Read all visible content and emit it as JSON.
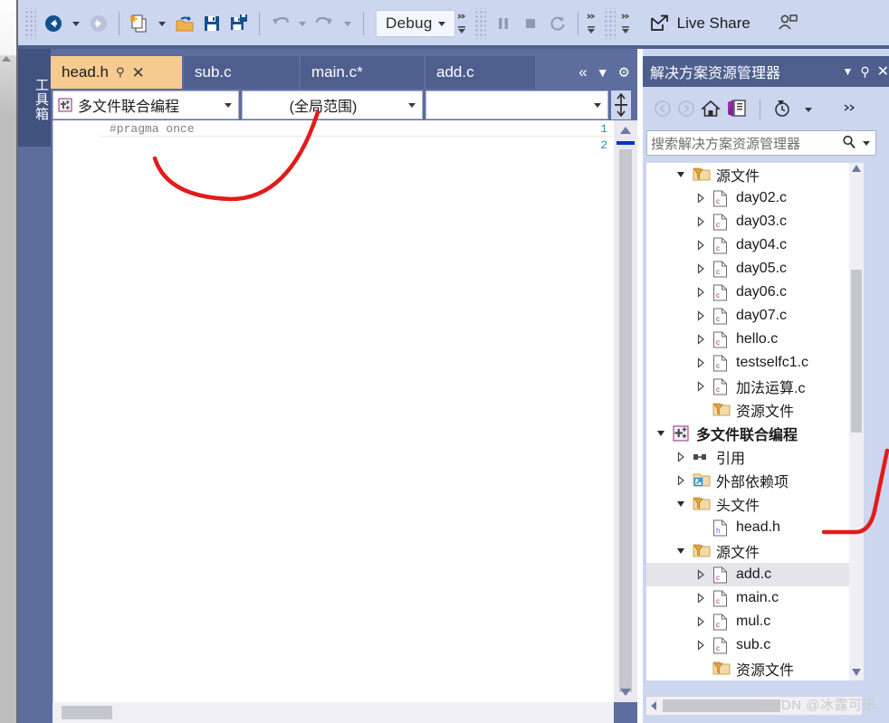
{
  "toolbar": {
    "items": [
      {
        "name": "grip",
        "label": ""
      },
      {
        "name": "navigate-backward-icon",
        "label": ""
      },
      {
        "name": "navigate-backward-dropdown",
        "label": ""
      },
      {
        "name": "navigate-forward-icon",
        "label": ""
      },
      {
        "name": "new-item-icon",
        "label": ""
      },
      {
        "name": "new-item-dropdown",
        "label": ""
      },
      {
        "name": "open-file-icon",
        "label": ""
      },
      {
        "name": "save-icon",
        "label": ""
      },
      {
        "name": "save-all-icon",
        "label": ""
      },
      {
        "name": "undo-icon",
        "label": ""
      },
      {
        "name": "redo-icon",
        "label": ""
      }
    ],
    "config_label": "Debug",
    "pause_label": "",
    "stop_label": "",
    "restart_label": "",
    "live_share_label": "Live Share"
  },
  "toolbox": {
    "label": "工具箱"
  },
  "editor": {
    "tabs": [
      {
        "label": "head.h",
        "active": true,
        "modified": false
      },
      {
        "label": "sub.c",
        "active": false,
        "modified": false
      },
      {
        "label": "main.c*",
        "active": false,
        "modified": true
      },
      {
        "label": "add.c",
        "active": false,
        "modified": false
      }
    ],
    "tabstrip_buttons": [
      "«",
      "▼",
      "⚙"
    ],
    "nav": {
      "project": "多文件联合编程",
      "scope": "(全局范围)",
      "member": ""
    },
    "lines": [
      {
        "number": "1",
        "text": "#pragma once"
      },
      {
        "number": "2",
        "text": ""
      }
    ]
  },
  "solution_explorer": {
    "title": "解决方案资源管理器",
    "toolbar_icons": [
      "back-icon",
      "forward-icon",
      "home-icon",
      "sync-with-active-document-icon",
      "pending-changes-icon"
    ],
    "search_placeholder": "搜索解决方案资源管理器",
    "tree": [
      {
        "indent": 1,
        "arrow": "open",
        "icon": "folder-filter",
        "label": "源文件",
        "bold": false,
        "selected": false
      },
      {
        "indent": 2,
        "arrow": "closed",
        "icon": "c-file",
        "label": "day02.c",
        "bold": false,
        "selected": false
      },
      {
        "indent": 2,
        "arrow": "closed",
        "icon": "c-file",
        "label": "day03.c",
        "bold": false,
        "selected": false
      },
      {
        "indent": 2,
        "arrow": "closed",
        "icon": "c-file",
        "label": "day04.c",
        "bold": false,
        "selected": false
      },
      {
        "indent": 2,
        "arrow": "closed",
        "icon": "c-file",
        "label": "day05.c",
        "bold": false,
        "selected": false
      },
      {
        "indent": 2,
        "arrow": "closed",
        "icon": "c-file",
        "label": "day06.c",
        "bold": false,
        "selected": false
      },
      {
        "indent": 2,
        "arrow": "closed",
        "icon": "c-file",
        "label": "day07.c",
        "bold": false,
        "selected": false
      },
      {
        "indent": 2,
        "arrow": "closed",
        "icon": "c-file",
        "label": "hello.c",
        "bold": false,
        "selected": false
      },
      {
        "indent": 2,
        "arrow": "closed",
        "icon": "c-file",
        "label": "testselfc1.c",
        "bold": false,
        "selected": false
      },
      {
        "indent": 2,
        "arrow": "closed",
        "icon": "c-file",
        "label": "加法运算.c",
        "bold": false,
        "selected": false
      },
      {
        "indent": 2,
        "arrow": "none",
        "icon": "folder-filter",
        "label": "资源文件",
        "bold": false,
        "selected": false
      },
      {
        "indent": 0,
        "arrow": "open",
        "icon": "project",
        "label": "多文件联合编程",
        "bold": true,
        "selected": false
      },
      {
        "indent": 1,
        "arrow": "closed",
        "icon": "references",
        "label": "引用",
        "bold": false,
        "selected": false
      },
      {
        "indent": 1,
        "arrow": "closed",
        "icon": "ext-deps",
        "label": "外部依赖项",
        "bold": false,
        "selected": false
      },
      {
        "indent": 1,
        "arrow": "open",
        "icon": "folder-filter",
        "label": "头文件",
        "bold": false,
        "selected": false
      },
      {
        "indent": 2,
        "arrow": "none",
        "icon": "h-file",
        "label": "head.h",
        "bold": false,
        "selected": false
      },
      {
        "indent": 1,
        "arrow": "open",
        "icon": "folder-filter",
        "label": "源文件",
        "bold": false,
        "selected": false
      },
      {
        "indent": 2,
        "arrow": "closed",
        "icon": "c-file",
        "label": "add.c",
        "bold": false,
        "selected": true
      },
      {
        "indent": 2,
        "arrow": "closed",
        "icon": "c-file",
        "label": "main.c",
        "bold": false,
        "selected": false
      },
      {
        "indent": 2,
        "arrow": "closed",
        "icon": "c-file",
        "label": "mul.c",
        "bold": false,
        "selected": false
      },
      {
        "indent": 2,
        "arrow": "closed",
        "icon": "c-file",
        "label": "sub.c",
        "bold": false,
        "selected": false
      },
      {
        "indent": 2,
        "arrow": "none",
        "icon": "folder-filter",
        "label": "资源文件",
        "bold": false,
        "selected": false
      }
    ]
  },
  "watermark": "CSDN @冰露可乐",
  "annotations": {
    "color": "#e21b1b"
  }
}
